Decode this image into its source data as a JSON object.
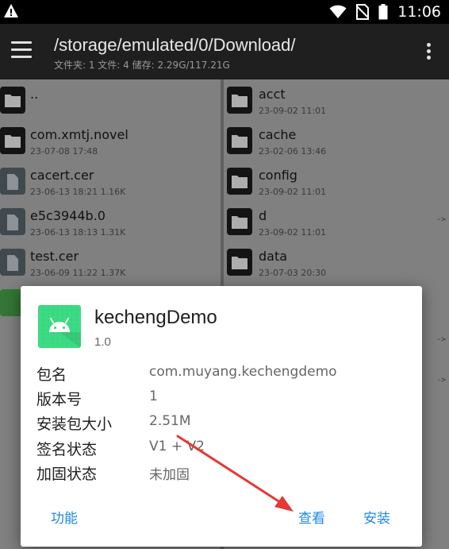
{
  "status_bar": {
    "time": "11:06"
  },
  "app_bar": {
    "path": "/storage/emulated/0/Download/",
    "summary": "文件夹: 1  文件: 4  储存: 2.29G/117.21G"
  },
  "left_pane": [
    {
      "name": "..",
      "meta": "",
      "type": "folder"
    },
    {
      "name": "com.xmtj.novel",
      "meta": "23-07-08 17:48",
      "type": "folder"
    },
    {
      "name": "cacert.cer",
      "meta": "23-06-13 18:21  1.16K",
      "type": "file"
    },
    {
      "name": "e5c3944b.0",
      "meta": "23-06-13 18:13  1.31K",
      "type": "file"
    },
    {
      "name": "test.cer",
      "meta": "23-06-09 11:22  1.37K",
      "type": "file"
    }
  ],
  "right_pane": [
    {
      "name": "acct",
      "meta": "23-09-02 11:01",
      "type": "folder",
      "link": ""
    },
    {
      "name": "cache",
      "meta": "23-02-06 13:46",
      "type": "folder",
      "link": ""
    },
    {
      "name": "config",
      "meta": "23-09-02 11:01",
      "type": "folder",
      "link": ""
    },
    {
      "name": "d",
      "meta": "23-09-02 11:01",
      "type": "folder",
      "link": "->"
    },
    {
      "name": "data",
      "meta": "23-07-03 20:30",
      "type": "folder",
      "link": ""
    }
  ],
  "right_pane_extra_links": [
    "->",
    "->"
  ],
  "dialog": {
    "app_name": "kechengDemo",
    "version": "1.0",
    "rows": [
      {
        "label": "包名",
        "value": "com.muyang.kechengdemo"
      },
      {
        "label": "版本号",
        "value": "1"
      },
      {
        "label": "安装包大小",
        "value": "2.51M"
      },
      {
        "label": "签名状态",
        "value": "V1 + V2"
      },
      {
        "label": "加固状态",
        "value": "未加固"
      }
    ],
    "buttons": {
      "function": "功能",
      "view": "查看",
      "install": "安装"
    }
  },
  "colors": {
    "accent": "#1e88e5",
    "annotation_arrow": "#e53935",
    "android_green": "#3ddc84"
  },
  "icons": [
    "warning-icon",
    "wifi-icon",
    "no-sim-icon",
    "battery-icon",
    "menu-icon",
    "more-vert-icon",
    "folder-icon",
    "file-icon",
    "android-icon"
  ]
}
